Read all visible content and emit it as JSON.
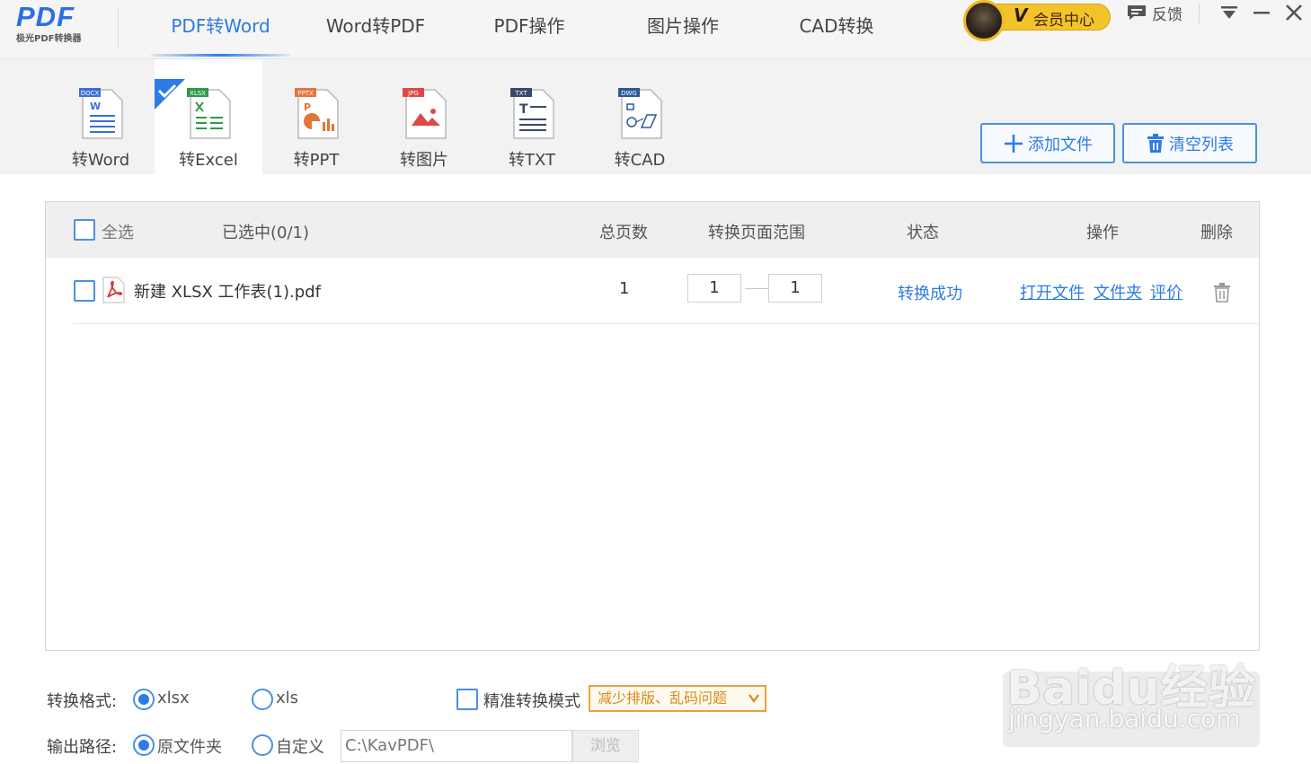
{
  "app": {
    "logo_text": "PDF",
    "logo_subtitle": "极光PDF转换器"
  },
  "nav": {
    "items": [
      {
        "label": "PDF转Word",
        "active": true
      },
      {
        "label": "Word转PDF",
        "active": false
      },
      {
        "label": "PDF操作",
        "active": false
      },
      {
        "label": "图片操作",
        "active": false
      },
      {
        "label": "CAD转换",
        "active": false
      }
    ]
  },
  "header": {
    "vip_badge": "V",
    "vip_label": "会员中心",
    "feedback_label": "反馈"
  },
  "converters": {
    "items": [
      {
        "label": "转Word",
        "badge": "DOCX",
        "badge_color": "#3a6fd8",
        "icon": "word-doc-icon"
      },
      {
        "label": "转Excel",
        "badge": "XLSX",
        "badge_color": "#2e9a4a",
        "icon": "excel-doc-icon",
        "selected": true
      },
      {
        "label": "转PPT",
        "badge": "PPTX",
        "badge_color": "#e8733a",
        "icon": "ppt-doc-icon"
      },
      {
        "label": "转图片",
        "badge": "JPG",
        "badge_color": "#e04848",
        "icon": "image-doc-icon"
      },
      {
        "label": "转TXT",
        "badge": "TXT",
        "badge_color": "#3a4a6a",
        "icon": "txt-doc-icon"
      },
      {
        "label": "转CAD",
        "badge": "DWG",
        "badge_color": "#2a5a9a",
        "icon": "cad-doc-icon"
      }
    ]
  },
  "actions": {
    "add_file": "添加文件",
    "clear_list": "清空列表"
  },
  "table": {
    "select_all": "全选",
    "selected_count": "已选中(0/1)",
    "col_pages": "总页数",
    "col_range": "转换页面范围",
    "col_status": "状态",
    "col_actions": "操作",
    "col_delete": "删除",
    "rows": [
      {
        "file_name": "新建 XLSX 工作表(1).pdf",
        "pages": "1",
        "range_from": "1",
        "range_to": "1",
        "status": "转换成功",
        "open_file": "打开文件",
        "folder": "文件夹",
        "rate": "评价"
      }
    ]
  },
  "options": {
    "format_label": "转换格式:",
    "format_xlsx": "xlsx",
    "format_xls": "xls",
    "precise_mode": "精准转换模式",
    "precise_tip": "减少排版、乱码问题",
    "output_label": "输出路径:",
    "output_original": "原文件夹",
    "output_custom": "自定义",
    "output_path": "C:\\KavPDF\\",
    "browse": "浏览"
  },
  "watermark": {
    "brand": "Baidu经验",
    "url": "jingyan.baidu.com"
  },
  "colors": {
    "accent": "#2d7be5",
    "vip": "#f3c32b",
    "tip": "#e8a33a"
  }
}
